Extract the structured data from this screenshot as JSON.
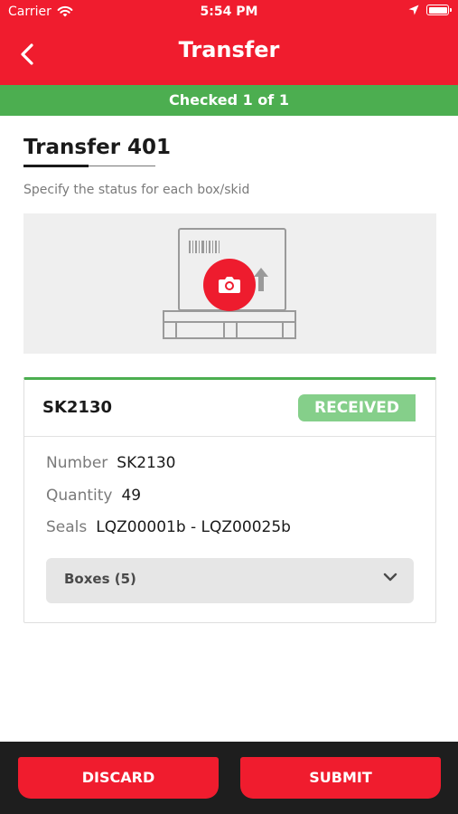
{
  "status_bar": {
    "carrier": "Carrier",
    "time": "5:54 PM"
  },
  "nav": {
    "title": "Transfer"
  },
  "progress": {
    "text": "Checked 1 of 1"
  },
  "page": {
    "heading": "Transfer 401",
    "instruction": "Specify the status for each box/skid"
  },
  "skid": {
    "id": "SK2130",
    "status": "RECEIVED",
    "fields": [
      {
        "label": "Number",
        "value": "SK2130"
      },
      {
        "label": "Quantity",
        "value": "49"
      },
      {
        "label": "Seals",
        "value": "LQZ00001b - LQZ00025b"
      }
    ],
    "boxes_label": "Boxes (5)"
  },
  "actions": {
    "discard": "DISCARD",
    "submit": "SUBMIT"
  },
  "colors": {
    "brand_red": "#f01c2e",
    "success_green": "#4cae50",
    "badge_green": "#85cf8a"
  },
  "icons": [
    "wifi-icon",
    "location-arrow-icon",
    "battery-icon",
    "back-chevron-icon",
    "box-pallet-illustration",
    "camera-icon",
    "chevron-down-icon"
  ]
}
